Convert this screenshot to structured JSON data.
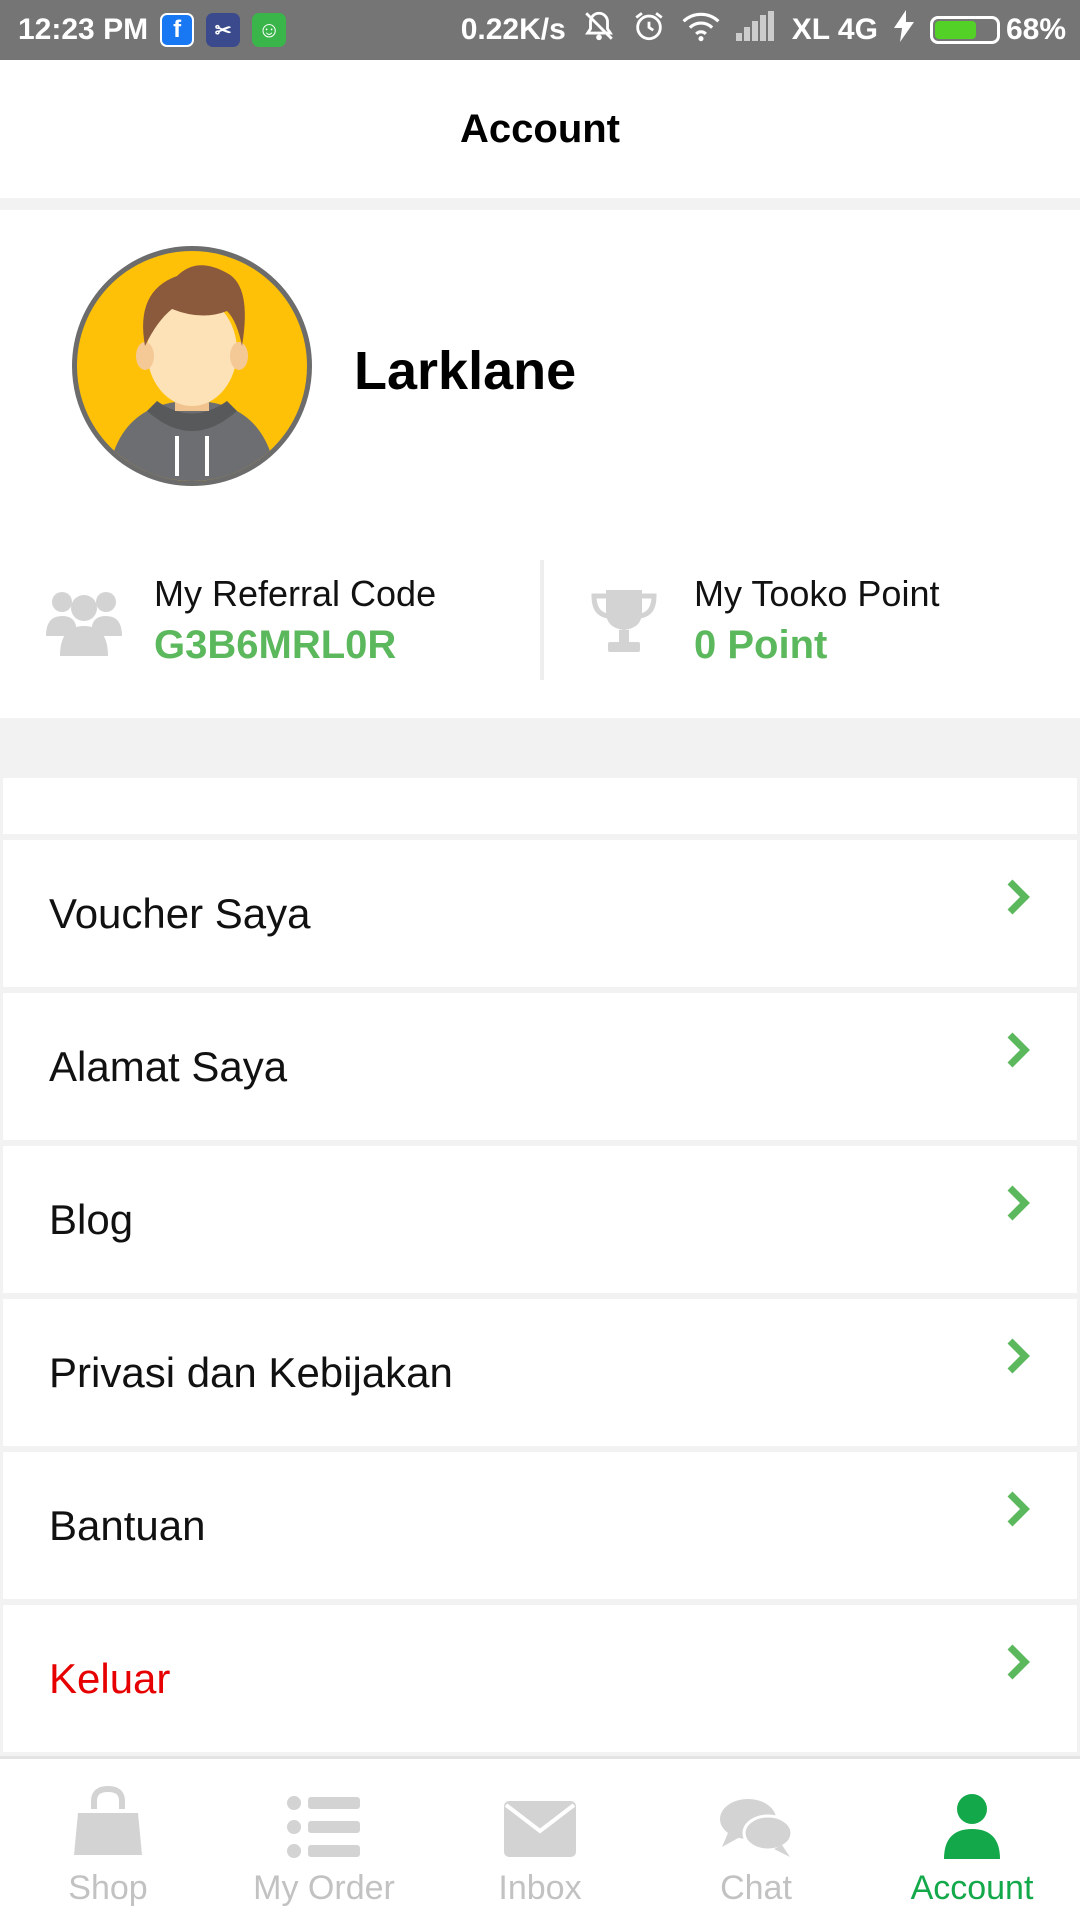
{
  "status_bar": {
    "time": "12:23 PM",
    "apps": [
      {
        "name": "facebook-icon",
        "glyph": "f",
        "color": "#1877f2"
      },
      {
        "name": "scissors-app-icon",
        "glyph": "✂",
        "color": "#3a4a8c"
      },
      {
        "name": "android-app-icon",
        "glyph": "☺",
        "color": "#3ab54a"
      }
    ],
    "network_speed": "0.22K/s",
    "carrier": "XL 4G",
    "battery": "68%",
    "battery_level": 0.68,
    "battery_color": "#53d126"
  },
  "header": {
    "title": "Account"
  },
  "profile": {
    "username": "Larklane",
    "referral": {
      "label": "My Referral Code",
      "value": "G3B6MRL0R",
      "icon": "group-icon"
    },
    "points": {
      "label": "My Tooko Point",
      "value": "0 Point",
      "icon": "trophy-icon"
    }
  },
  "menu": [
    {
      "label": "Voucher Saya",
      "name": "menu-item-voucher"
    },
    {
      "label": "Alamat Saya",
      "name": "menu-item-address"
    },
    {
      "label": "Blog",
      "name": "menu-item-blog"
    },
    {
      "label": "Privasi dan Kebijakan",
      "name": "menu-item-privacy"
    },
    {
      "label": "Bantuan",
      "name": "menu-item-help"
    },
    {
      "label": "Keluar",
      "name": "menu-item-logout",
      "danger": true
    }
  ],
  "bottom_nav": [
    {
      "label": "Shop",
      "icon": "shopping-bag-icon"
    },
    {
      "label": "My Order",
      "icon": "list-icon"
    },
    {
      "label": "Inbox",
      "icon": "envelope-icon"
    },
    {
      "label": "Chat",
      "icon": "chat-bubbles-icon"
    },
    {
      "label": "Account",
      "icon": "user-icon",
      "active": true
    }
  ],
  "colors": {
    "accent_green": "#5cb85c",
    "nav_active": "#13a94a",
    "nav_inactive": "#c2c2c2",
    "danger": "#e60000",
    "avatar_bg": "#ffc107"
  }
}
